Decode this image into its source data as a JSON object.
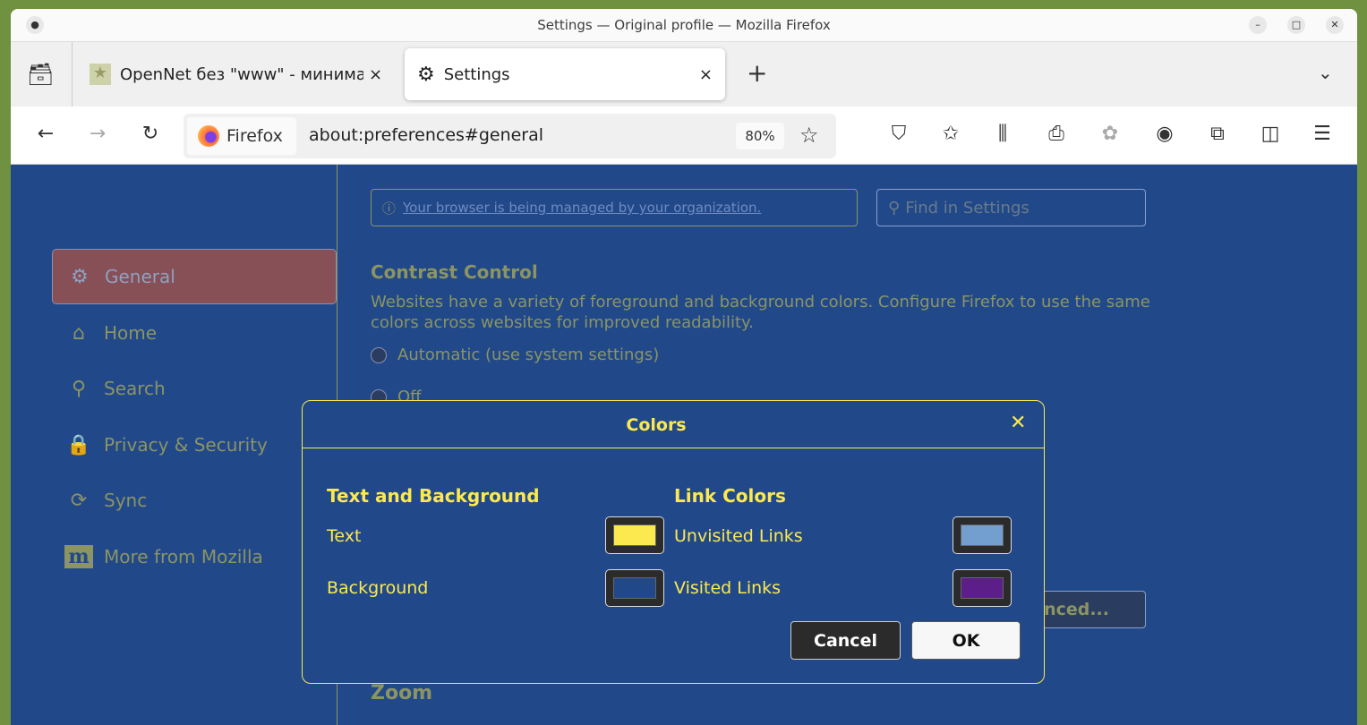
{
  "window": {
    "title": "Settings — Original profile — Mozilla Firefox"
  },
  "tabs": [
    {
      "label": "OpenNet без \"www\" - минима",
      "close": "×"
    },
    {
      "label": "Settings",
      "close": "×"
    }
  ],
  "new_tab": "+",
  "nav": {
    "identity": "Firefox",
    "url": "about:preferences#general",
    "zoom": "80%"
  },
  "banner": {
    "text": "Your browser is being managed by your organization."
  },
  "search": {
    "placeholder": "Find in Settings"
  },
  "sidebar": {
    "items": [
      {
        "label": "General",
        "icon": "⚙"
      },
      {
        "label": "Home",
        "icon": "⌂"
      },
      {
        "label": "Search",
        "icon": "⚲"
      },
      {
        "label": "Privacy & Security",
        "icon": "🔒"
      },
      {
        "label": "Sync",
        "icon": "⟳"
      },
      {
        "label": "More from Mozilla",
        "icon": "m"
      }
    ]
  },
  "main": {
    "heading": "Contrast Control",
    "description": "Websites have a variety of foreground and background colors. Configure Firefox to use the same colors across websites for improved readability.",
    "options": [
      "Automatic (use system settings)",
      "Off"
    ],
    "advanced_button": "nced...",
    "zoom_heading": "Zoom"
  },
  "dialog": {
    "title": "Colors",
    "close": "✕",
    "text_bg": {
      "heading": "Text and Background",
      "items": [
        {
          "label": "Text",
          "color": "#fce94f"
        },
        {
          "label": "Background",
          "color": "#21498a"
        }
      ]
    },
    "links": {
      "heading": "Link Colors",
      "items": [
        {
          "label": "Unvisited Links",
          "color": "#729fcf"
        },
        {
          "label": "Visited Links",
          "color": "#5c1f8a"
        }
      ]
    },
    "cancel": "Cancel",
    "ok": "OK"
  }
}
